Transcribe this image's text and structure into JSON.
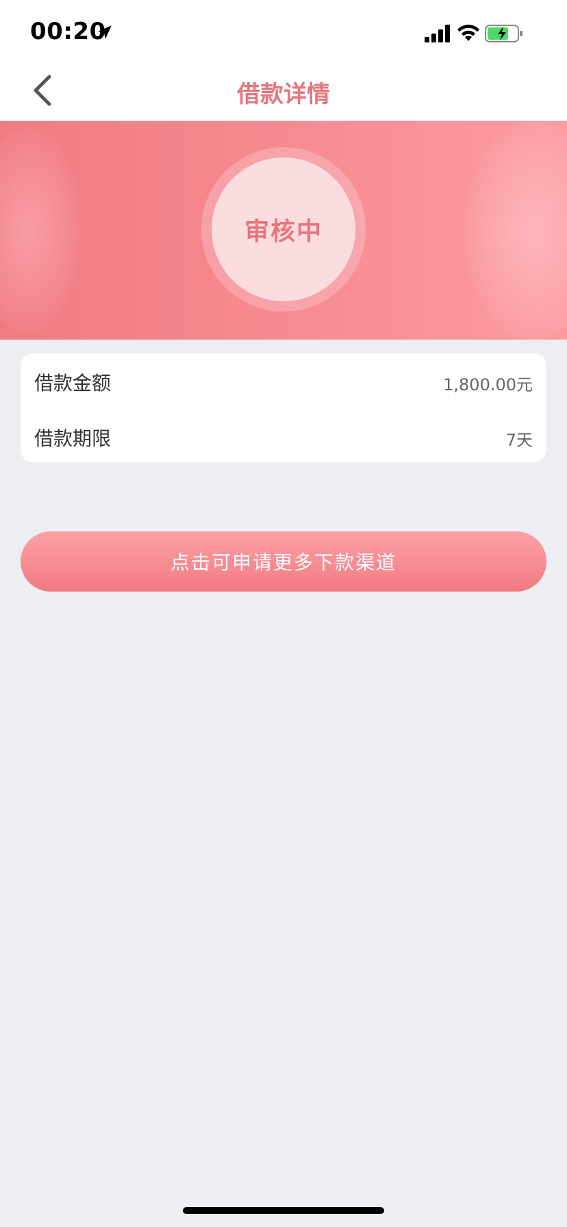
{
  "status_bar": {
    "time": "00:20",
    "icons": [
      "location-arrow-icon",
      "signal-icon",
      "wifi-icon",
      "battery-charging-icon"
    ]
  },
  "nav": {
    "title": "借款详情",
    "back_icon": "chevron-left-icon"
  },
  "banner": {
    "status": "审核中"
  },
  "loan_info": {
    "rows": [
      {
        "label": "借款金额",
        "value": "1,800.00元"
      },
      {
        "label": "借款期限",
        "value": "7天"
      }
    ]
  },
  "cta": {
    "label": "点击可申请更多下款渠道"
  },
  "colors": {
    "accent": "#e5767d",
    "banner_start": "#f17b83",
    "banner_end": "#fb9ca1",
    "background": "#edeef2",
    "button_top": "#fca1a6",
    "button_bottom": "#f27b83"
  }
}
